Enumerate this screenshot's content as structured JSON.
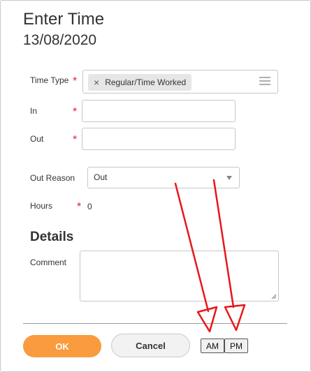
{
  "header": {
    "title": "Enter Time",
    "date": "13/08/2020"
  },
  "form": {
    "time_type": {
      "label": "Time Type",
      "required_mark": "*",
      "value": "Regular/Time Worked",
      "remove_glyph": "×"
    },
    "in": {
      "label": "In",
      "required_mark": "*",
      "value": ""
    },
    "out": {
      "label": "Out",
      "required_mark": "*",
      "value": ""
    },
    "out_reason": {
      "label": "Out Reason",
      "value": "Out"
    },
    "hours": {
      "label": "Hours",
      "required_mark": "*",
      "value": "0"
    }
  },
  "details": {
    "heading": "Details",
    "comment_label": "Comment",
    "comment_value": ""
  },
  "footer": {
    "ok_label": "OK",
    "cancel_label": "Cancel",
    "am_label": "AM",
    "pm_label": "PM"
  },
  "colors": {
    "accent": "#f99b3e",
    "required": "#e41f35",
    "annotation": "#e8171a"
  },
  "icons": [
    "remove-icon",
    "list-icon",
    "chevron-down-icon",
    "resize-handle-icon"
  ]
}
